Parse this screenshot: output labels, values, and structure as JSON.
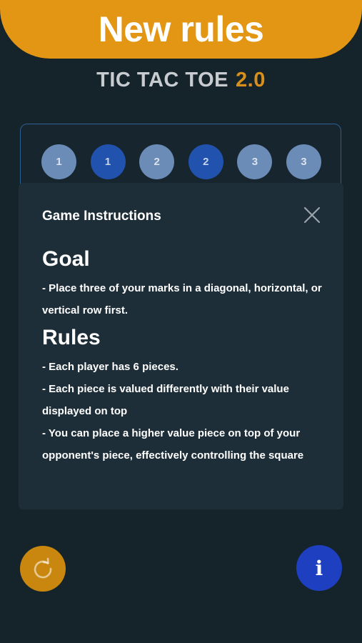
{
  "banner": {
    "title": "New rules"
  },
  "app": {
    "title": "TIC TAC TOE",
    "version": "2.0"
  },
  "pieces": [
    {
      "value": "1",
      "style": "light"
    },
    {
      "value": "1",
      "style": "dark"
    },
    {
      "value": "2",
      "style": "light"
    },
    {
      "value": "2",
      "style": "dark"
    },
    {
      "value": "3",
      "style": "light"
    },
    {
      "value": "3",
      "style": "dark"
    }
  ],
  "modal": {
    "header": "Game Instructions",
    "goal_title": "Goal",
    "goal_lines": [
      "- Place three of your marks in a diagonal, horizontal, or",
      "vertical row first."
    ],
    "rules_title": "Rules",
    "rules_lines": [
      "- Each player has 6 pieces.",
      "- Each piece is valued differently with their value",
      "displayed on top",
      "- You can place a higher value piece on top of your",
      "opponent's piece, effectively controlling the square"
    ]
  },
  "buttons": {
    "restart_icon": "restart-icon",
    "info_icon": "info-icon",
    "info_glyph": "i"
  },
  "colors": {
    "banner": "#e29613",
    "background": "#15232b",
    "modal": "#1d2e38",
    "piece_light": "#6b8cb7",
    "piece_dark": "#2152ad",
    "version": "#d9901b"
  }
}
